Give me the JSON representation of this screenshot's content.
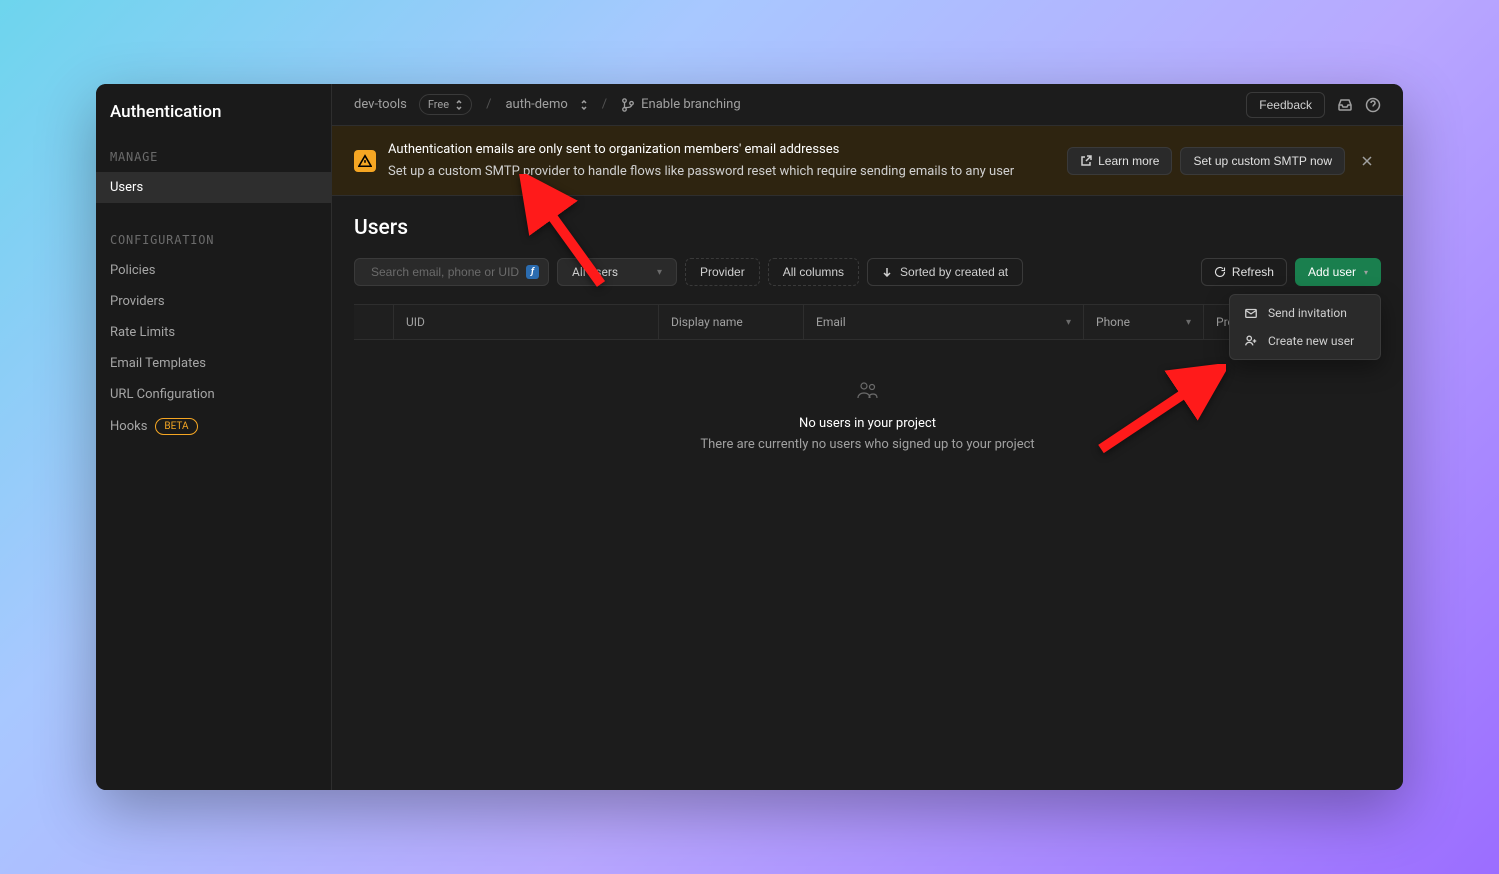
{
  "sidebar": {
    "title": "Authentication",
    "sections": [
      {
        "label": "MANAGE",
        "items": [
          {
            "label": "Users",
            "active": true
          }
        ]
      },
      {
        "label": "CONFIGURATION",
        "items": [
          {
            "label": "Policies"
          },
          {
            "label": "Providers"
          },
          {
            "label": "Rate Limits"
          },
          {
            "label": "Email Templates"
          },
          {
            "label": "URL Configuration"
          },
          {
            "label": "Hooks",
            "badge": "BETA"
          }
        ]
      }
    ]
  },
  "topbar": {
    "org": "dev-tools",
    "plan": "Free",
    "project": "auth-demo",
    "branching": "Enable branching",
    "feedback": "Feedback"
  },
  "banner": {
    "title": "Authentication emails are only sent to organization members' email addresses",
    "subtitle": "Set up a custom SMTP provider to handle flows like password reset which require sending emails to any user",
    "learn_more": "Learn more",
    "setup": "Set up custom SMTP now"
  },
  "page": {
    "title": "Users",
    "search_placeholder": "Search email, phone or UID",
    "filter_users": "All users",
    "filter_provider": "Provider",
    "filter_columns": "All columns",
    "sort": "Sorted by created at",
    "refresh": "Refresh",
    "add_user": "Add user"
  },
  "dropdown": {
    "send_invitation": "Send invitation",
    "create_user": "Create new user"
  },
  "columns": [
    "UID",
    "Display name",
    "Email",
    "Phone",
    "Provider"
  ],
  "empty": {
    "title": "No users in your project",
    "subtitle": "There are currently no users who signed up to your project"
  }
}
